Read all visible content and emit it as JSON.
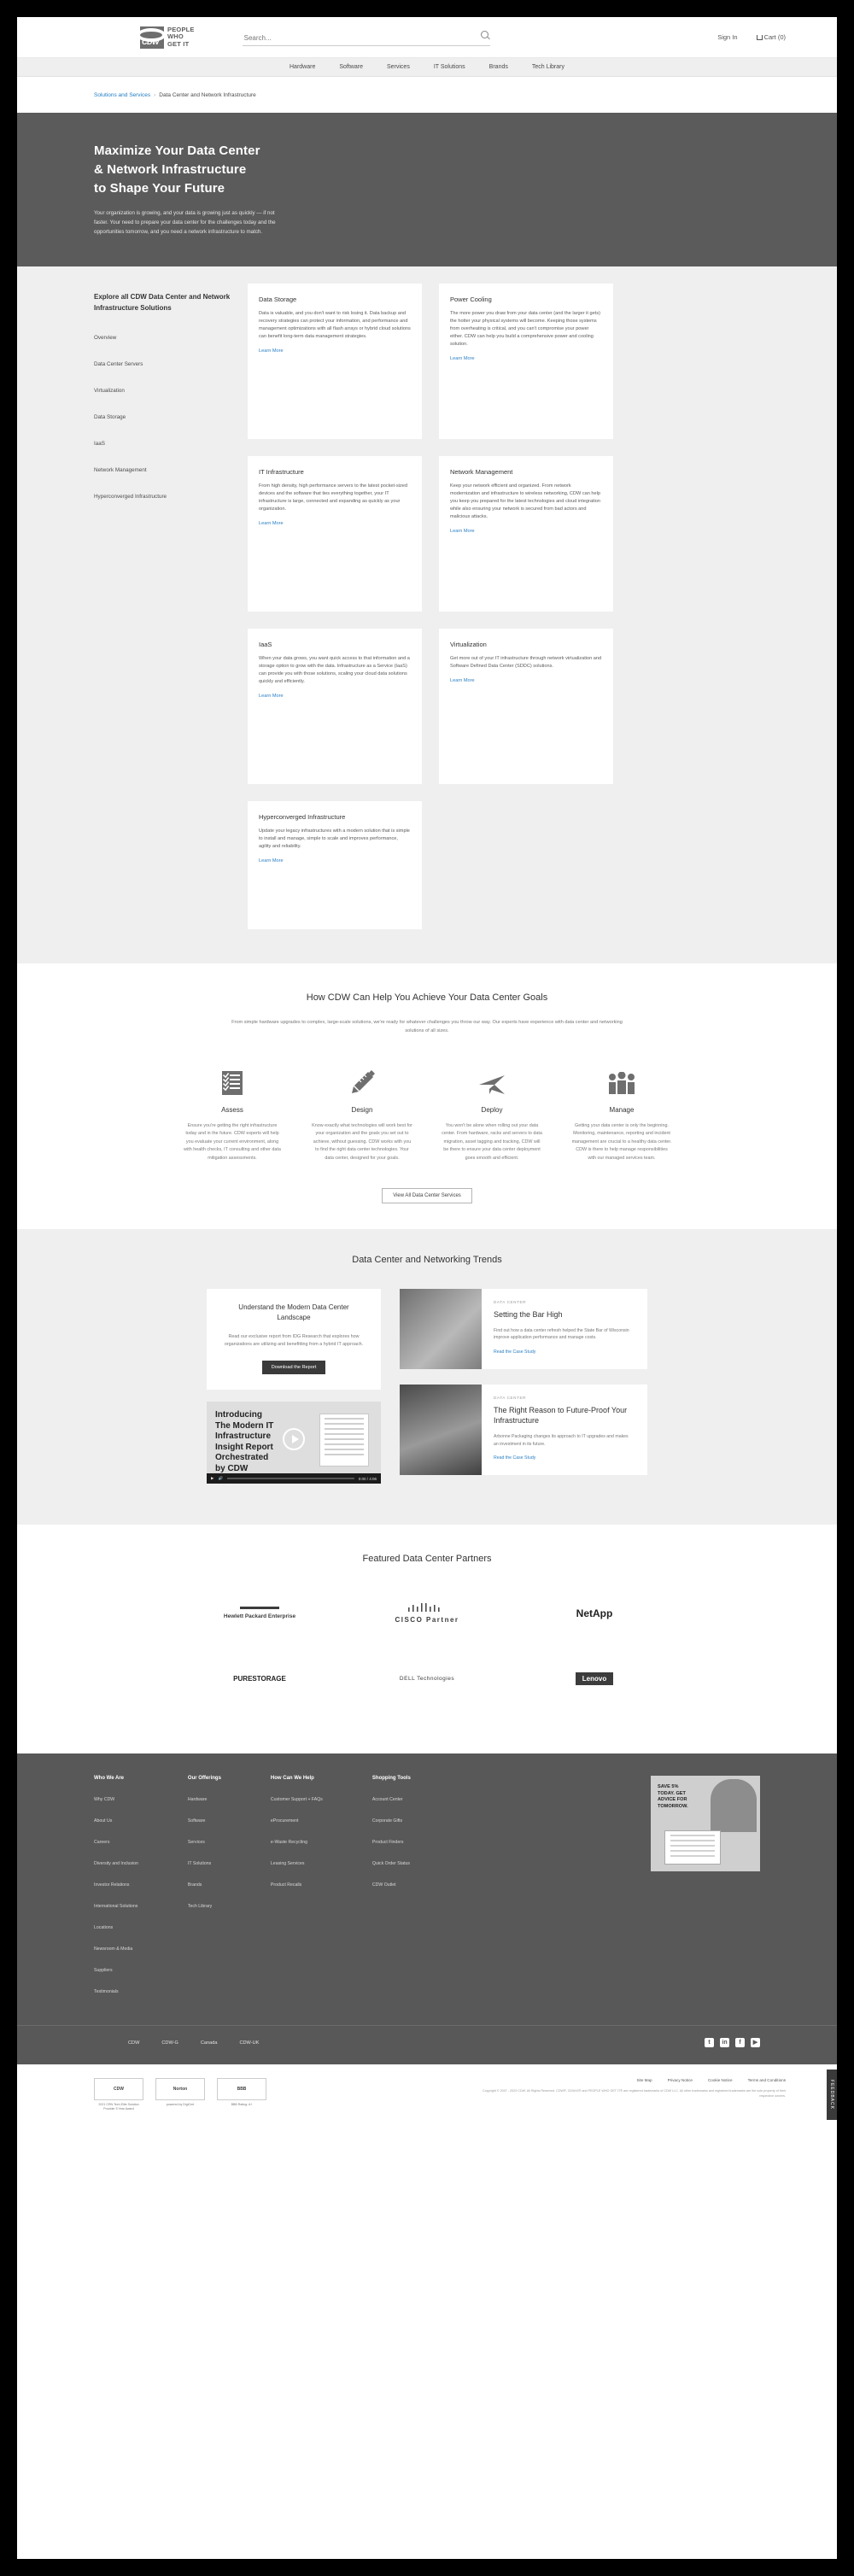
{
  "header": {
    "logo_text": "CDW",
    "logo_tagline_1": "PEOPLE",
    "logo_tagline_2": "WHO",
    "logo_tagline_3": "GET IT",
    "search_placeholder": "Search...",
    "sign_in": "Sign In",
    "cart": "Cart (0)"
  },
  "nav": {
    "items": [
      {
        "label": "Hardware"
      },
      {
        "label": "Software"
      },
      {
        "label": "Services"
      },
      {
        "label": "IT Solutions"
      },
      {
        "label": "Brands"
      },
      {
        "label": "Tech Library"
      }
    ]
  },
  "breadcrumb": {
    "parent": "Solutions and Services",
    "separator": "›",
    "current": "Data Center and Network Infrastructure"
  },
  "hero": {
    "title_line_1": "Maximize Your Data Center",
    "title_line_2": "& Network Infrastructure",
    "title_line_3": "to Shape Your Future",
    "body": "Your organization is growing, and your data is growing just as quickly — if not faster. Your need to prepare your data center for the challenges today and the opportunities tomorrow, and you need a network infrastructure to match."
  },
  "solutions": {
    "nav_title": "Explore all CDW Data Center and Network Infrastructure Solutions",
    "nav_items": [
      {
        "label": "Overview"
      },
      {
        "label": "Data Center Servers"
      },
      {
        "label": "Virtualization"
      },
      {
        "label": "Data Storage"
      },
      {
        "label": "IaaS"
      },
      {
        "label": "Network Management"
      },
      {
        "label": "Hyperconverged Infrastructure"
      }
    ],
    "learn_more": "Learn More",
    "cards": [
      {
        "title": "Data Storage",
        "body": "Data is valuable, and you don't want to risk losing it. Data backup and recovery strategies can protect your information, and performance and management optimizations with all flash arrays or hybrid cloud solutions can benefit long-term data management strategies."
      },
      {
        "title": "Power Cooling",
        "body": "The more power you draw from your data center (and the larger it gets) the hotter your physical systems will become. Keeping those systems from overheating is critical, and you can't compromise your power either. CDW can help you build a comprehensive power and cooling solution."
      },
      {
        "title": "IT Infrastructure",
        "body": "From high density, high performance servers to the latest pocket-sized devices and the software that ties everything together, your IT infrastructure is large, connected and expanding as quickly as your organization."
      },
      {
        "title": "Network Management",
        "body": "Keep your network efficient and organized. From network modernization and infrastructure to wireless networking, CDW can help you keep you prepared for the latest technologies and cloud integration while also ensuring your network is secured from bad actors and malicious attacks."
      },
      {
        "title": "IaaS",
        "body": "When your data grows, you want quick access to that information and a storage option to grow with the data. Infrastructure as a Service (IaaS) can provide you with those solutions, scaling your cloud data solutions quickly and efficiently."
      },
      {
        "title": "Virtualization",
        "body": "Get more out of your IT infrastructure through network virtualization and Software Defined Data Center (SDDC) solutions."
      },
      {
        "title": "Hyperconverged Infrastructure",
        "body": "Update your legacy infrastructures with a modern solution that is simple to install and manage, simple to scale and improves performance, agility and reliability."
      }
    ]
  },
  "help": {
    "title": "How CDW Can Help You Achieve Your Data Center Goals",
    "subtitle": "From simple hardware upgrades to complex, large-scale solutions, we're ready for whatever challenges you throw our way. Our experts have experience with data center and networking solutions of all sizes.",
    "pillars": [
      {
        "icon": "checklist-icon",
        "title": "Assess",
        "body": "Ensure you're getting the right infrastructure today and in the future. CDW experts will help you evaluate your current environment, along with health checks, IT consulting and other data mitigation assessments."
      },
      {
        "icon": "pencil-ruler-icon",
        "title": "Design",
        "body": "Know exactly what technologies will work best for your organization and the goals you set out to achieve, without guessing. CDW works with you to find the right data center technologies. Your data center, designed for your goals."
      },
      {
        "icon": "paper-plane-icon",
        "title": "Deploy",
        "body": "You won't be alone when rolling out your data center. From hardware, racks and servers to data migration, asset tagging and tracking, CDW will be there to ensure your data center deployment goes smooth and efficient."
      },
      {
        "icon": "people-group-icon",
        "title": "Manage",
        "body": "Getting your data center is only the beginning. Monitoring, maintenance, reporting and incident management are crucial to a healthy data center. CDW is there to help manage responsibilities with our managed services team."
      }
    ],
    "cta": "View All Data Center Services"
  },
  "trends": {
    "title": "Data Center and Networking Trends",
    "report": {
      "title": "Understand the Modern Data Center Landscape",
      "body": "Read our exclusive report from IDG Research that explores how organizations are utilizing and benefitting from a hybrid IT approach.",
      "cta": "Download the Report"
    },
    "video": {
      "title_line_1": "Introducing",
      "title_line_2": "The Modern IT",
      "title_line_3": "Infrastructure",
      "title_line_4": "Insight Report",
      "title_line_5": "Orchestrated",
      "title_line_6": "by CDW",
      "time": "0:00 / 4:06"
    },
    "articles": [
      {
        "kicker": "Data Center",
        "title": "Setting the Bar High",
        "body": "Find out how a data center refresh helped the State Bar of Wisconsin improve application performance and manage costs.",
        "link": "Read the Case Study"
      },
      {
        "kicker": "Data Center",
        "title": "The Right Reason to Future-Proof Your Infrastructure",
        "body": "Arbonne Packaging changes its approach to IT upgrades and makes an investment in its future.",
        "link": "Read the Case Study"
      }
    ]
  },
  "partners": {
    "title": "Featured Data Center Partners",
    "row1": [
      {
        "name": "Hewlett Packard Enterprise"
      },
      {
        "name": "CISCO Partner"
      },
      {
        "name": "NetApp"
      }
    ],
    "row2": [
      {
        "name": "PURESTORAGE"
      },
      {
        "name": "DELL Technologies"
      },
      {
        "name": "Lenovo"
      }
    ]
  },
  "footer": {
    "columns": [
      {
        "heading": "Who We Are",
        "items": [
          "Why CDW",
          "About Us",
          "Careers",
          "Diversity and Inclusion",
          "Investor Relations",
          "International Solutions",
          "Locations",
          "Newsroom & Media",
          "Suppliers",
          "Testimonials"
        ]
      },
      {
        "heading": "Our Offerings",
        "items": [
          "Hardware",
          "Software",
          "Services",
          "IT Solutions",
          "Brands",
          "Tech Library"
        ]
      },
      {
        "heading": "How Can We Help",
        "items": [
          "Customer Support + FAQs",
          "eProcurement",
          "e-Waste Recycling",
          "Leasing Services",
          "Product Recalls"
        ]
      },
      {
        "heading": "Shopping Tools",
        "items": [
          "Account Center",
          "Corporate Gifts",
          "Product Finders",
          "Quick Order Status",
          "CDW Outlet"
        ]
      }
    ],
    "promo": {
      "line1": "SAVE 5%",
      "line2": "TODAY. GET",
      "line3": "ADVICE FOR",
      "line4": "TOMORROW."
    },
    "brand_links": [
      "CDW",
      "CDW-G",
      "Canada",
      "CDW-UK"
    ],
    "socials": [
      "twitter-icon",
      "linkedin-icon",
      "facebook-icon",
      "youtube-icon"
    ]
  },
  "legal": {
    "badges": [
      {
        "mark": "CDW",
        "caption": "2021 CRN Tech Elite Solution Provider 5 Year Award"
      },
      {
        "mark": "Norton",
        "caption": "powered by DigiCert"
      },
      {
        "mark": "BBB",
        "caption": "BBB Rating: A+"
      }
    ],
    "links": [
      "Site Map",
      "Privacy Notice",
      "Cookie Notice",
      "Terms and Conditions"
    ],
    "copyright": "Copyright © 2007 - 2020 CDW. All Rights Reserved. CDW®, CDW•G® and PEOPLE WHO GET IT® are registered trademarks of CDW LLC. All other trademarks and registered trademarks are the sole property of their respective owners.",
    "feedback": "FEEDBACK"
  }
}
